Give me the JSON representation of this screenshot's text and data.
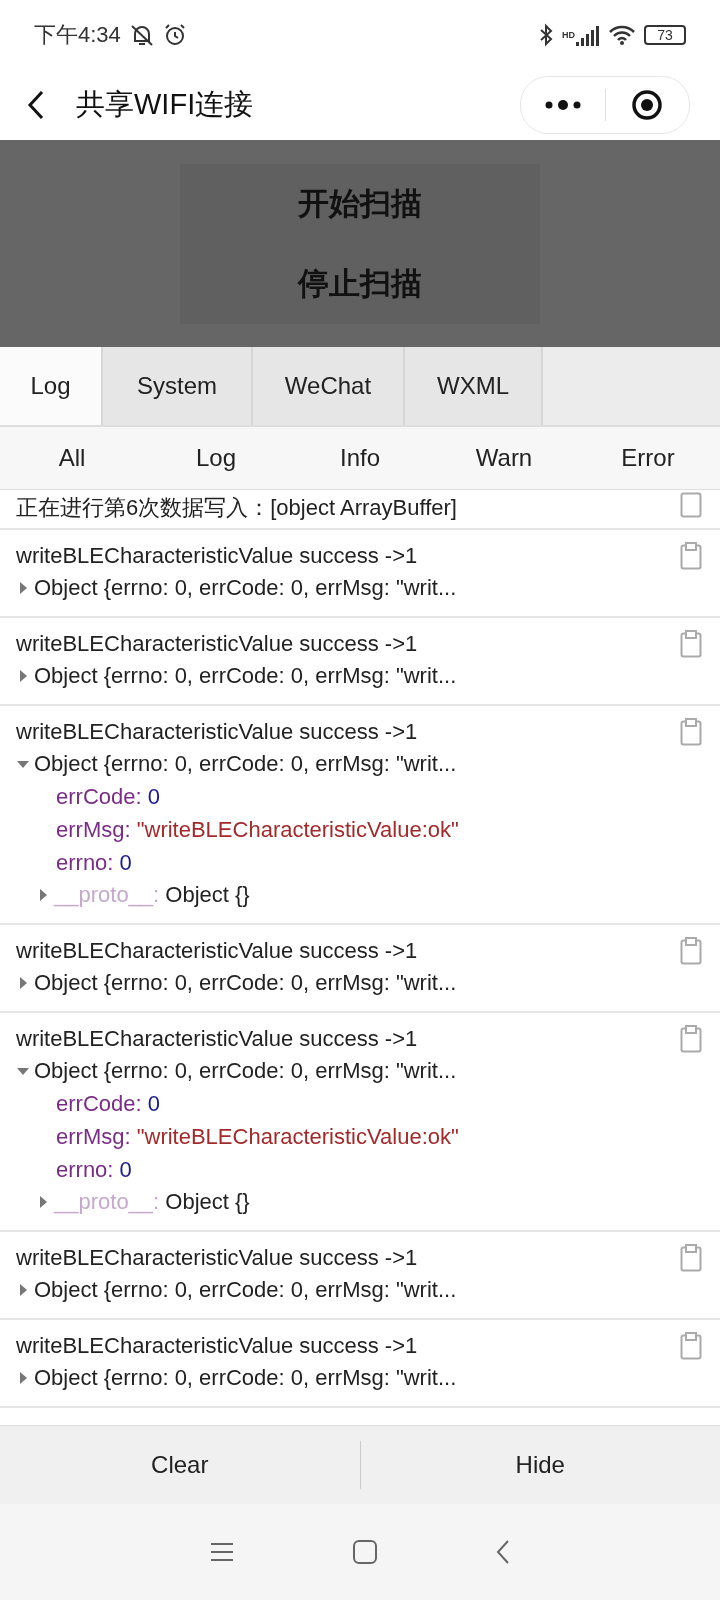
{
  "status_bar": {
    "time": "下午4:34",
    "battery": "73",
    "network": "HD"
  },
  "nav_bar": {
    "title": "共享WIFI连接"
  },
  "scan_buttons": [
    "开始扫描",
    "停止扫描"
  ],
  "tabs": [
    {
      "label": "Log",
      "selected": true
    },
    {
      "label": "System",
      "selected": false
    },
    {
      "label": "WeChat",
      "selected": false
    },
    {
      "label": "WXML",
      "selected": false
    }
  ],
  "filters": [
    "All",
    "Log",
    "Info",
    "Warn",
    "Error"
  ],
  "log_entries": [
    {
      "kind": "text",
      "message": "正在进行第6次数据写入：[object ArrayBuffer]"
    },
    {
      "kind": "object",
      "message": "writeBLECharacteristicValue success ->1",
      "summary": "Object {errno: 0, errCode: 0, errMsg: \"writ...",
      "expanded": false
    },
    {
      "kind": "object",
      "message": "writeBLECharacteristicValue success ->1",
      "summary": "Object {errno: 0, errCode: 0, errMsg: \"writ...",
      "expanded": false
    },
    {
      "kind": "object",
      "message": "writeBLECharacteristicValue success ->1",
      "summary": "Object {errno: 0, errCode: 0, errMsg: \"writ...",
      "expanded": true,
      "properties": [
        {
          "key": "errCode:",
          "value": "0",
          "kind": "number"
        },
        {
          "key": "errMsg:",
          "value": "\"writeBLECharacteristicValue:ok\"",
          "kind": "string"
        },
        {
          "key": "errno:",
          "value": "0",
          "kind": "number"
        }
      ],
      "proto": {
        "key": "__proto__:",
        "value": "Object {}"
      }
    },
    {
      "kind": "object",
      "message": "writeBLECharacteristicValue success ->1",
      "summary": "Object {errno: 0, errCode: 0, errMsg: \"writ...",
      "expanded": false
    },
    {
      "kind": "object",
      "message": "writeBLECharacteristicValue success ->1",
      "summary": "Object {errno: 0, errCode: 0, errMsg: \"writ...",
      "expanded": true,
      "properties": [
        {
          "key": "errCode:",
          "value": "0",
          "kind": "number"
        },
        {
          "key": "errMsg:",
          "value": "\"writeBLECharacteristicValue:ok\"",
          "kind": "string"
        },
        {
          "key": "errno:",
          "value": "0",
          "kind": "number"
        }
      ],
      "proto": {
        "key": "__proto__:",
        "value": "Object {}"
      }
    },
    {
      "kind": "object",
      "message": "writeBLECharacteristicValue success ->1",
      "summary": "Object {errno: 0, errCode: 0, errMsg: \"writ...",
      "expanded": false
    },
    {
      "kind": "object",
      "message": "writeBLECharacteristicValue success ->1",
      "summary": "Object {errno: 0, errCode: 0, errMsg: \"writ...",
      "expanded": false
    }
  ],
  "bottom_buttons": [
    "Clear",
    "Hide"
  ]
}
